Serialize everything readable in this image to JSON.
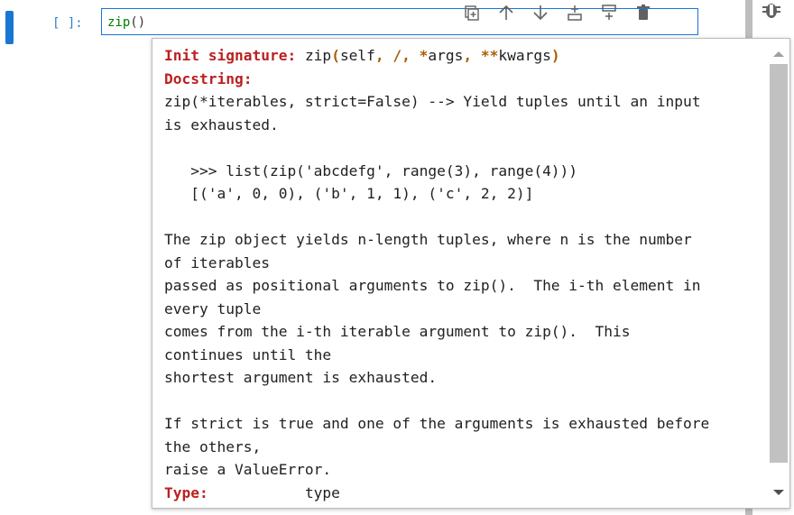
{
  "cell": {
    "prompt": "[ ]:",
    "code_func": "zip",
    "code_parens": "()"
  },
  "toolbar": {
    "buttons": [
      {
        "icon": "duplicate-cell-icon"
      },
      {
        "icon": "move-up-icon"
      },
      {
        "icon": "move-down-icon"
      },
      {
        "icon": "insert-above-icon"
      },
      {
        "icon": "insert-below-icon"
      },
      {
        "icon": "delete-cell-icon"
      }
    ]
  },
  "tooltip": {
    "init_signature_label": "Init signature:",
    "signature_name": "zip",
    "signature_args": {
      "open": "(",
      "self": "self",
      "comma1": ",",
      "slash": " /",
      "comma2": ",",
      "star": " *",
      "args": "args",
      "comma3": ",",
      "dstar": " **",
      "kwargs": "kwargs",
      "close": ")"
    },
    "docstring_label": "Docstring:",
    "doc_lines": [
      "zip(*iterables, strict=False) --> Yield tuples until an input",
      "is exhausted.",
      "",
      "   >>> list(zip('abcdefg', range(3), range(4)))",
      "   [('a', 0, 0), ('b', 1, 1), ('c', 2, 2)]",
      "",
      "The zip object yields n-length tuples, where n is the number",
      "of iterables",
      "passed as positional arguments to zip().  The i-th element in",
      "every tuple",
      "comes from the i-th iterable argument to zip().  This",
      "continues until the",
      "shortest argument is exhausted.",
      "",
      "If strict is true and one of the arguments is exhausted before",
      "the others,",
      "raise a ValueError."
    ],
    "type_label": "Type:",
    "type_value": "type"
  }
}
